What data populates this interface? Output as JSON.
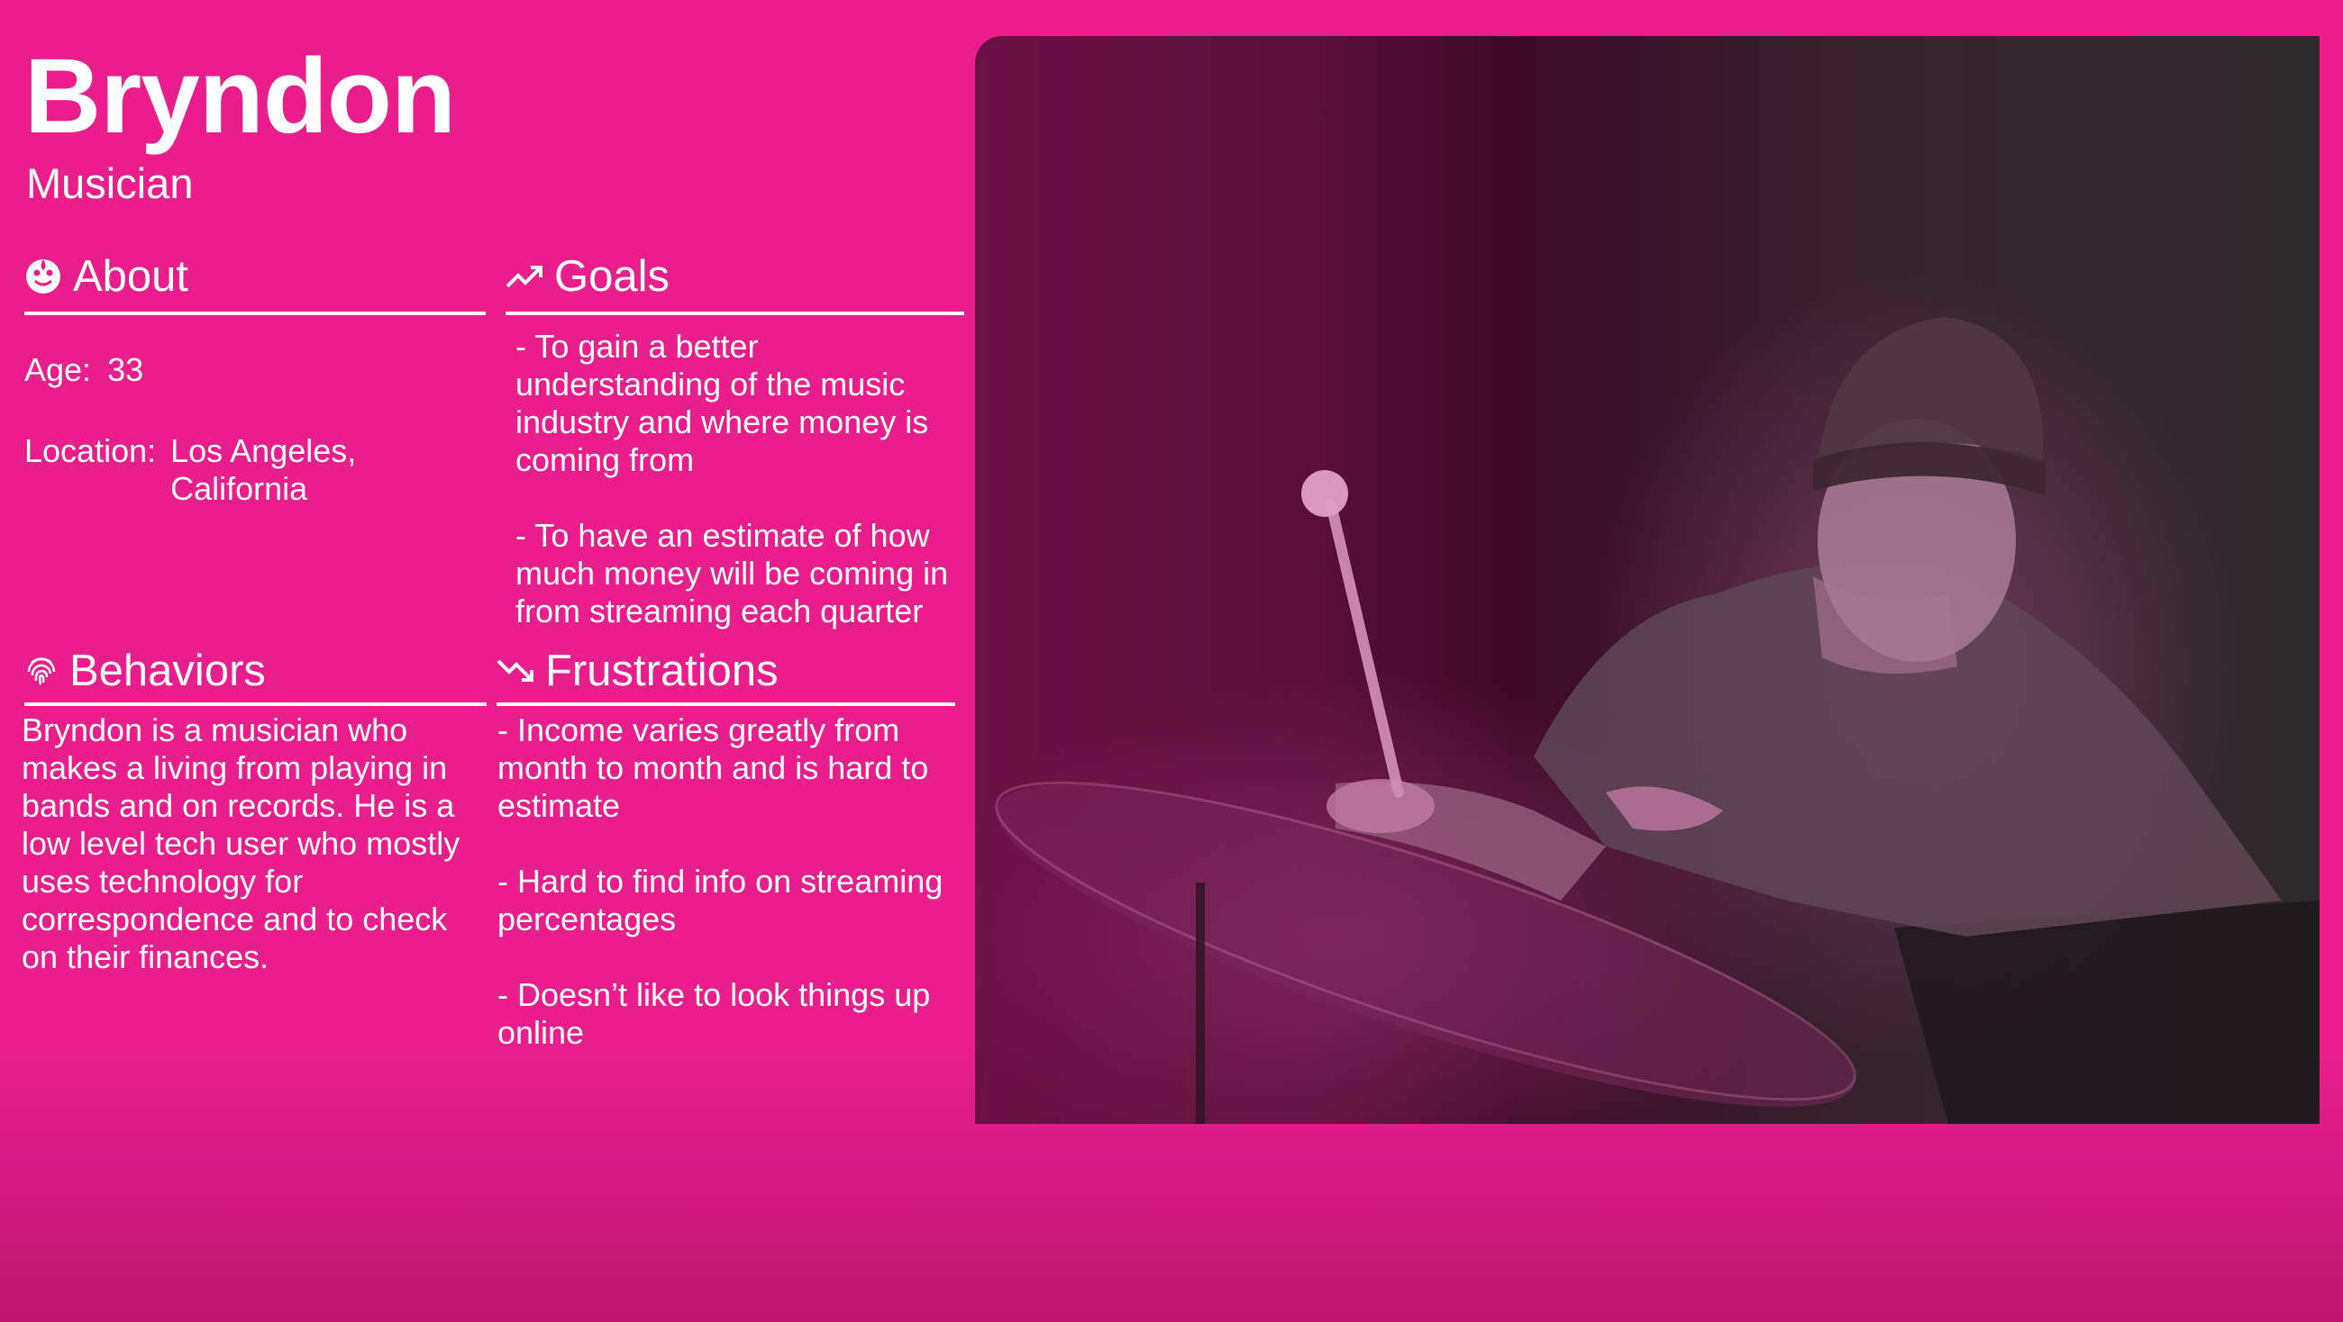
{
  "persona": {
    "name": "Bryndon",
    "role": "Musician"
  },
  "about": {
    "title": "About",
    "icon": "face-icon",
    "age_label": "Age:",
    "age_value": "33",
    "location_label": "Location:",
    "location_line1": "Los Angeles,",
    "location_line2": "California"
  },
  "goals": {
    "title": "Goals",
    "icon": "trending-up-icon",
    "items": [
      "- To gain a better understanding of the music industry and where money is coming from",
      "- To have an estimate of how much money will be coming in from streaming each quarter"
    ]
  },
  "behaviors": {
    "title": "Behaviors",
    "icon": "fingerprint-icon",
    "text": "Bryndon is a musician who makes a living from playing in bands and on records. He is a low level tech user who mostly uses technology for correspondence and to check on their finances."
  },
  "frustrations": {
    "title": "Frustrations",
    "icon": "trending-down-icon",
    "items": [
      "- Income varies greatly from month to month and is hard to estimate",
      "- Hard to find info on streaming percentages",
      "- Doesn’t like to look things up online"
    ]
  },
  "colors": {
    "background": "#e91e8c",
    "text": "#ffffff"
  },
  "photo": {
    "subject": "drummer-photo"
  }
}
